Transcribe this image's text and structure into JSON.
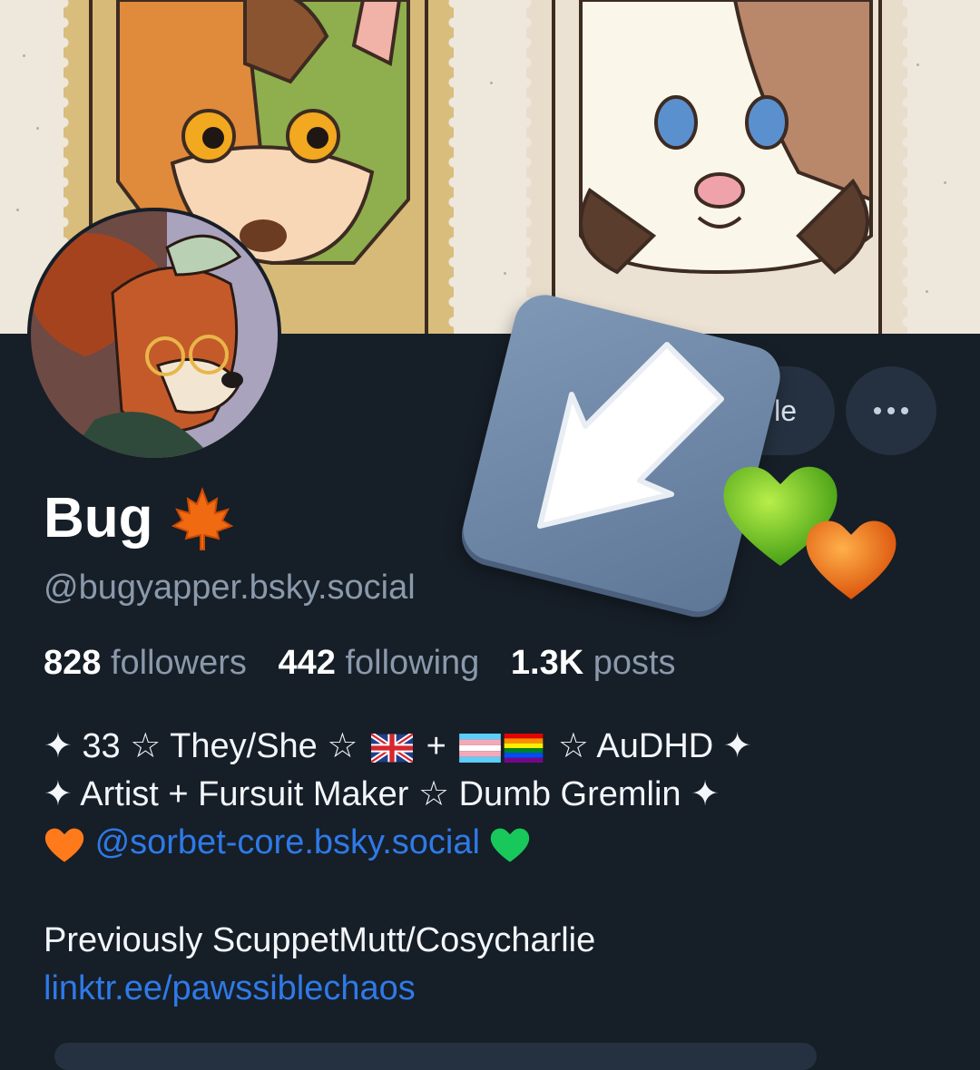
{
  "profile": {
    "display_name": "Bug",
    "name_emoji_icon": "maple-leaf-icon",
    "handle": "@bugyapper.bsky.social",
    "follow_button_label": "le",
    "more_button_icon": "more-dots-icon"
  },
  "stats": {
    "followers_count": "828",
    "followers_label": "followers",
    "following_count": "442",
    "following_label": "following",
    "posts_count": "1.3K",
    "posts_label": "posts"
  },
  "bio": {
    "line1_a": "✦ 33 ☆ They/She ☆",
    "line1_plus": "+",
    "line1_b": "☆ AuDHD ✦",
    "line2": "✦ Artist + Fursuit Maker ☆ Dumb Gremlin ✦",
    "mention": "@sorbet-core.bsky.social",
    "line5": "Previously ScuppetMutt/Cosycharlie",
    "link": "linktr.ee/pawssiblechaos"
  },
  "colors": {
    "background": "#161e27",
    "button_bg": "#253140",
    "muted_text": "#8a99ab",
    "link": "#2e7ae8",
    "banner_bg": "#eee7dc"
  },
  "overlay": {
    "icon": "arrow-down-left-icon",
    "hearts": [
      "green-heart-icon",
      "orange-heart-icon"
    ]
  }
}
